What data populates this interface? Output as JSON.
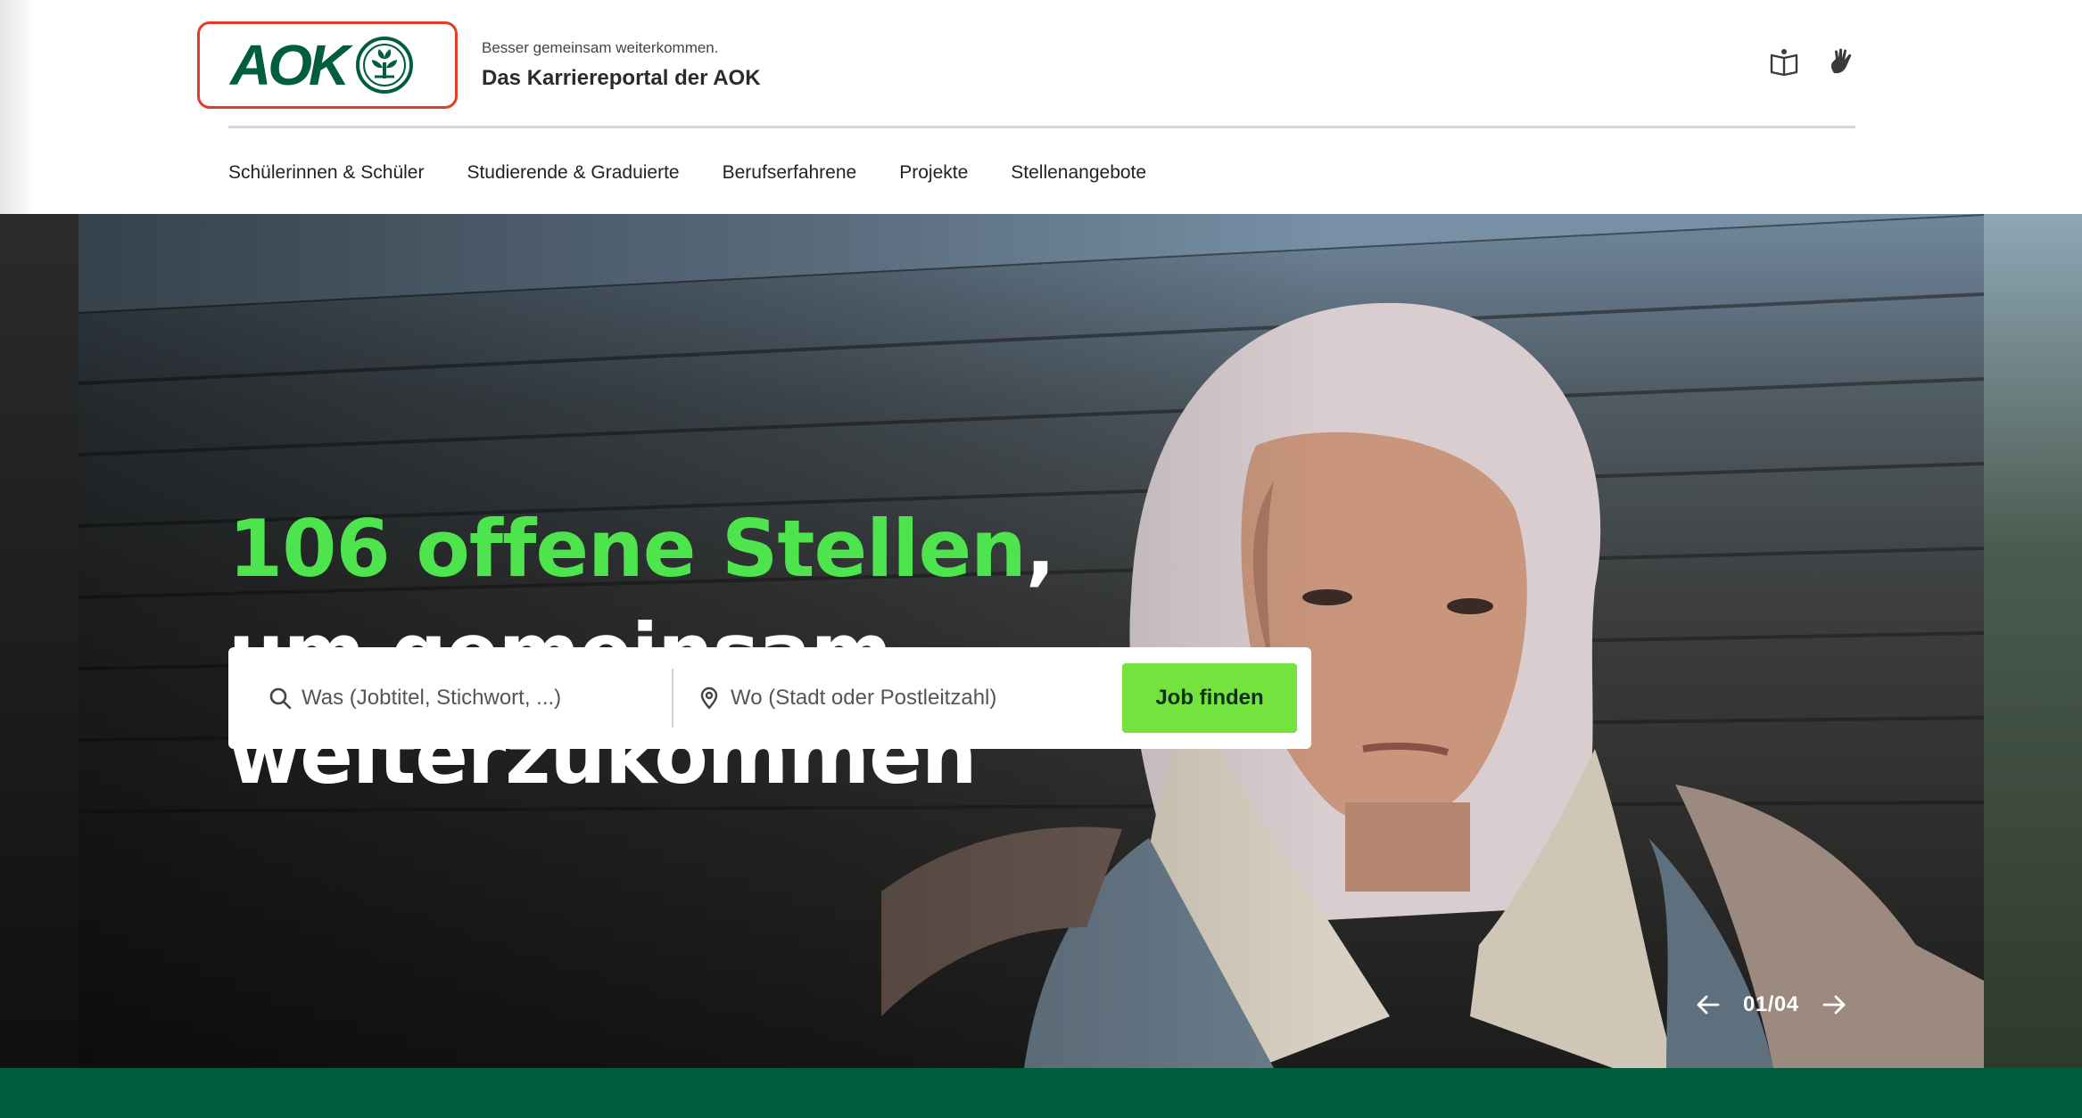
{
  "brand": {
    "logo_text": "AOK",
    "tagline_small": "Besser gemeinsam weiterkommen.",
    "tagline_big": "Das Karriereportal der AOK",
    "colors": {
      "brand_green": "#005e3f",
      "accent_green": "#4ee44e",
      "button_green": "#75e33d",
      "logo_highlight": "#e53a25"
    }
  },
  "toolbar": {
    "icons": [
      "easy-language-icon",
      "sign-language-icon"
    ]
  },
  "nav": {
    "items": [
      {
        "label": "Schülerinnen & Schüler"
      },
      {
        "label": "Studierende & Graduierte"
      },
      {
        "label": "Berufserfahrene"
      },
      {
        "label": "Projekte"
      },
      {
        "label": "Stellenangebote"
      }
    ]
  },
  "hero": {
    "headline_highlight": "106 offene Stellen",
    "headline_rest": ", um gemeinsam weiterzukommen",
    "search": {
      "what_placeholder": "Was (Jobtitel, Stichwort, ...)",
      "where_placeholder": "Wo (Stadt oder Postleitzahl)",
      "submit_label": "Job finden"
    },
    "pager": {
      "current": "01/04"
    }
  }
}
